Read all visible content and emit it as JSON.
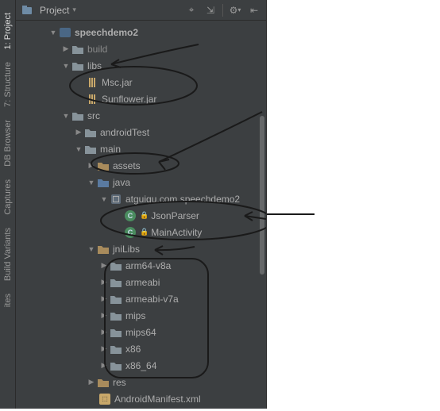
{
  "panel": {
    "title": "Project",
    "dropdown_glyph": "▾"
  },
  "toolbar": {
    "target": "⌖",
    "collapse": "⇲",
    "gear": "⚙",
    "gear_drop": "▾",
    "hide": "⇤"
  },
  "side_tabs": [
    {
      "label": "1: Project",
      "icon": "project"
    },
    {
      "label": "7: Structure",
      "icon": "structure"
    },
    {
      "label": "DB Browser",
      "icon": "db"
    },
    {
      "label": "Captures",
      "icon": "captures"
    },
    {
      "label": "Build Variants",
      "icon": "build"
    },
    {
      "label": "ites",
      "icon": "fav"
    }
  ],
  "tree": {
    "root": "speechdemo2",
    "build": "build",
    "libs": "libs",
    "jar1": "Msc.jar",
    "jar2": "Sunflower.jar",
    "src": "src",
    "androidTest": "androidTest",
    "main": "main",
    "assets": "assets",
    "java": "java",
    "package": "atguigu.com.speechdemo2",
    "class1": "JsonParser",
    "class2": "MainActivity",
    "jniLibs": "jniLibs",
    "abi1": "arm64-v8a",
    "abi2": "armeabi",
    "abi3": "armeabi-v7a",
    "abi4": "mips",
    "abi5": "mips64",
    "abi6": "x86",
    "abi7": "x86_64",
    "res": "res",
    "manifest": "AndroidManifest.xml"
  }
}
